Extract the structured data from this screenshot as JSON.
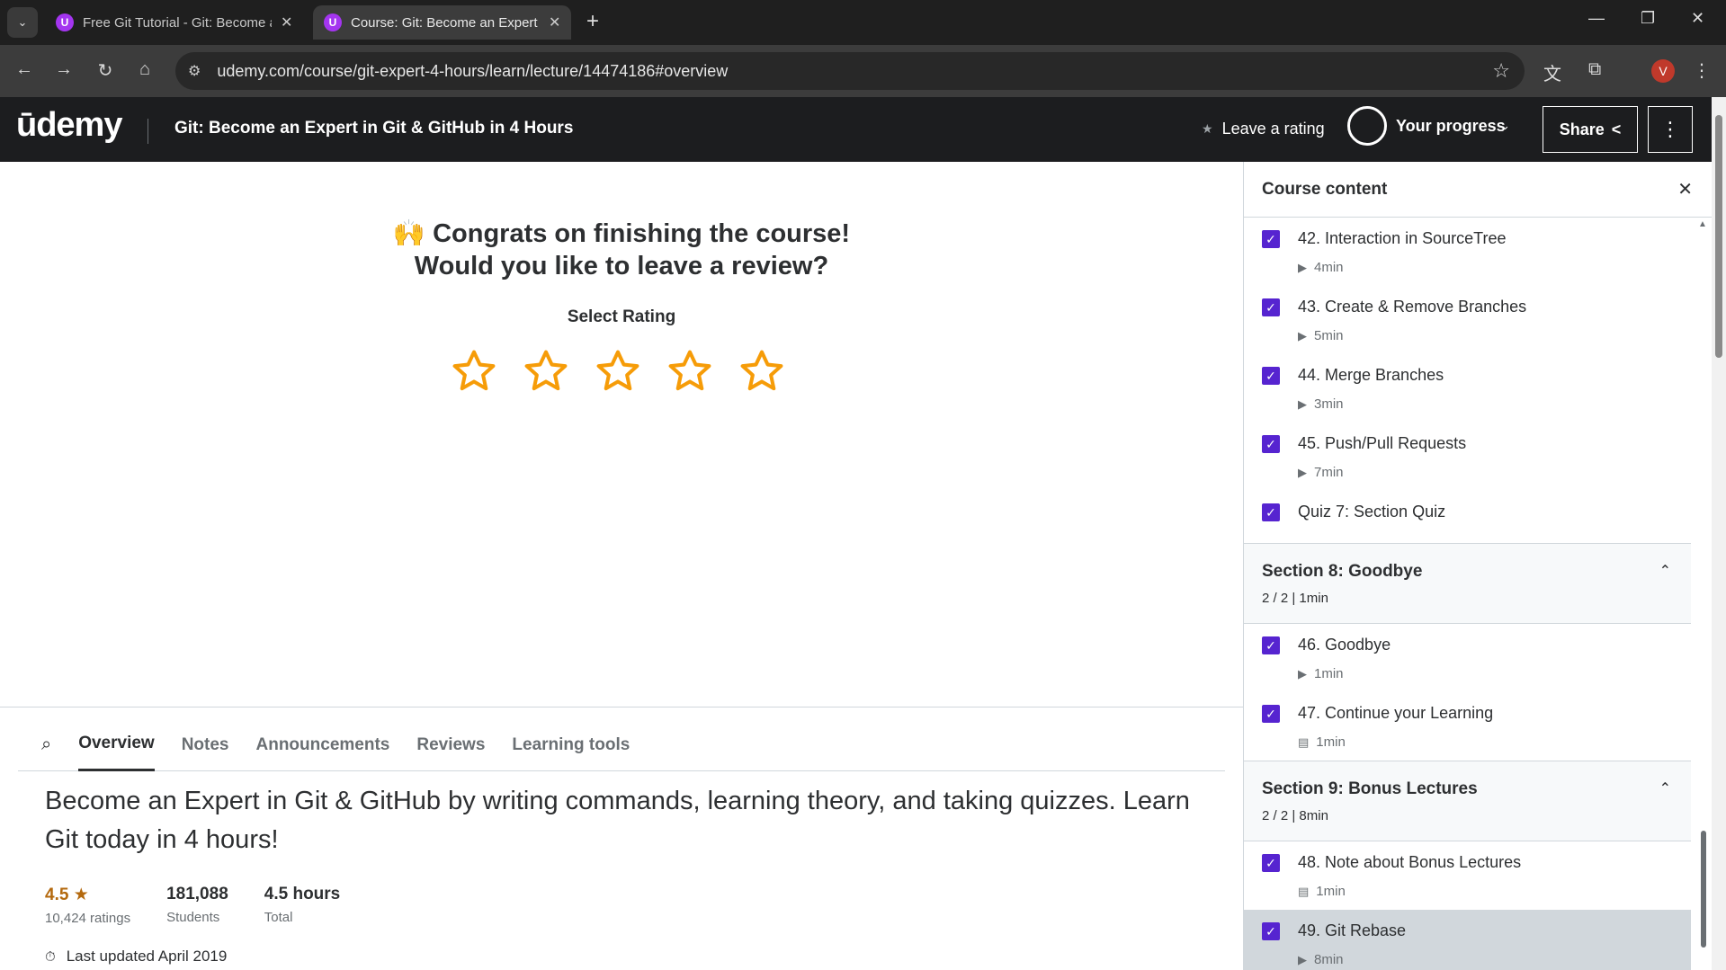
{
  "browser": {
    "tabs": [
      {
        "title": "Free Git Tutorial - Git: Become a"
      },
      {
        "title": "Course: Git: Become an Expert in"
      }
    ],
    "favicon_letter": "U",
    "url": "udemy.com/course/git-expert-4-hours/learn/lecture/14474186#overview",
    "profile_initial": "V"
  },
  "header": {
    "logo": "ūdemy",
    "course_title": "Git: Become an Expert in Git & GitHub in 4 Hours",
    "leave_rating": "Leave a rating",
    "your_progress": "Your progress",
    "share": "Share"
  },
  "review": {
    "emoji": "🙌",
    "line1": "Congrats on finishing the course!",
    "line2": "Would you like to leave a review?",
    "select_rating": "Select Rating",
    "star_count": 5,
    "star_color": "#f69c08"
  },
  "tabs": [
    "Overview",
    "Notes",
    "Announcements",
    "Reviews",
    "Learning tools"
  ],
  "overview": {
    "headline": "Become an Expert in Git & GitHub by writing commands, learning theory, and taking quizzes. Learn Git today in 4 hours!",
    "rating": {
      "value": "4.5",
      "label": "10,424 ratings"
    },
    "students": {
      "value": "181,088",
      "label": "Students"
    },
    "hours": {
      "value": "4.5 hours",
      "label": "Total"
    },
    "last_updated": "Last updated April 2019"
  },
  "sidebar": {
    "title": "Course content",
    "items": [
      {
        "kind": "lecture",
        "name": "42. Interaction in SourceTree",
        "duration": "4min",
        "icon": "video-icon"
      },
      {
        "kind": "lecture",
        "name": "43. Create & Remove Branches",
        "duration": "5min",
        "icon": "video-icon"
      },
      {
        "kind": "lecture",
        "name": "44. Merge Branches",
        "duration": "3min",
        "icon": "video-icon"
      },
      {
        "kind": "lecture",
        "name": "45. Push/Pull Requests",
        "duration": "7min",
        "icon": "video-icon"
      },
      {
        "kind": "quiz",
        "name": "Quiz 7: Section Quiz"
      },
      {
        "kind": "section",
        "name": "Section 8: Goodbye",
        "meta": "2 / 2 | 1min"
      },
      {
        "kind": "lecture",
        "name": "46. Goodbye",
        "duration": "1min",
        "icon": "video-icon"
      },
      {
        "kind": "lecture",
        "name": "47. Continue your Learning",
        "duration": "1min",
        "icon": "article-icon"
      },
      {
        "kind": "section",
        "name": "Section 9: Bonus Lectures",
        "meta": "2 / 2 | 8min"
      },
      {
        "kind": "lecture",
        "name": "48. Note about Bonus Lectures",
        "duration": "1min",
        "icon": "article-icon"
      },
      {
        "kind": "lecture",
        "name": "49. Git Rebase",
        "duration": "8min",
        "icon": "video-icon",
        "current": true
      }
    ]
  },
  "colors": {
    "accent": "#5624d0",
    "brand": "#a435f0",
    "header_bg": "#1c1d1f",
    "rating": "#b4690e"
  }
}
